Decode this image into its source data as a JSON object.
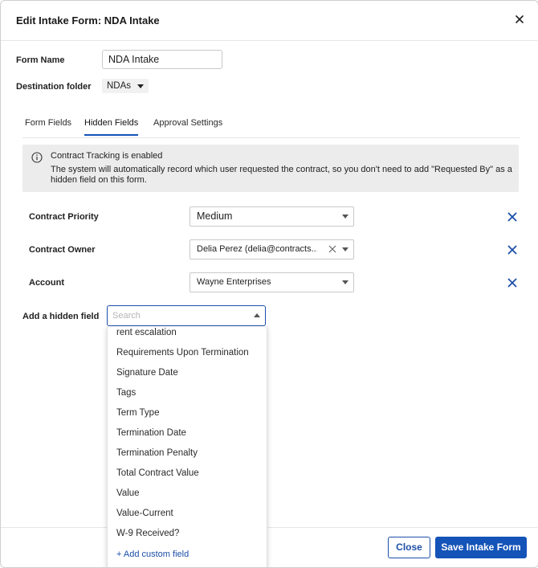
{
  "dialog": {
    "title": "Edit Intake Form: NDA Intake"
  },
  "form_name": {
    "label": "Form Name",
    "value": "NDA Intake"
  },
  "destination_folder": {
    "label": "Destination folder",
    "value": "NDAs"
  },
  "tabs": [
    {
      "label": "Form Fields",
      "active": false
    },
    {
      "label": "Hidden Fields",
      "active": true
    },
    {
      "label": "Approval Settings",
      "active": false
    }
  ],
  "banner": {
    "title": "Contract Tracking is enabled",
    "text": "The system will automatically record which user requested the contract, so you don't need to add \"Requested By\" as a hidden field on this form."
  },
  "hidden_fields": [
    {
      "label": "Contract Priority",
      "value": "Medium",
      "clearable": false
    },
    {
      "label": "Contract Owner",
      "value": "Delia Perez (delia@contracts...",
      "clearable": true
    },
    {
      "label": "Account",
      "value": "Wayne Enterprises",
      "clearable": false
    }
  ],
  "add_hidden_field": {
    "label": "Add a hidden field",
    "placeholder": "Search",
    "options": [
      "rent escalation",
      "Requirements Upon Termination",
      "Signature Date",
      "Tags",
      "Term Type",
      "Termination Date",
      "Termination Penalty",
      "Total Contract Value",
      "Value",
      "Value-Current",
      "W-9 Received?"
    ],
    "add_custom_label": "+ Add custom field"
  },
  "footer": {
    "close_label": "Close",
    "save_label": "Save Intake Form"
  },
  "colors": {
    "accent": "#1453b8",
    "remove_icon": "#1d4fa8",
    "banner_bg": "#ececec"
  }
}
